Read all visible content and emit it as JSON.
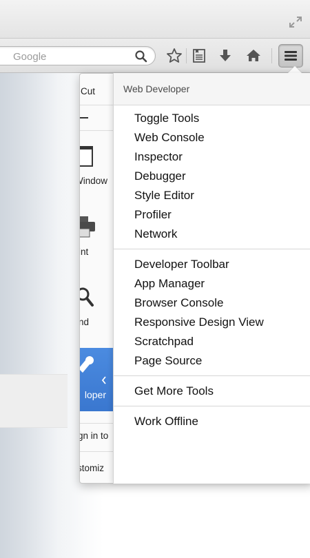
{
  "navbar": {
    "search_placeholder": "Google"
  },
  "main_menu": {
    "cut_label": "Cut",
    "new_window_label": "Window",
    "print_label": "int",
    "find_label": "nd",
    "developer_label": "loper",
    "sign_in_label": "gn in to",
    "customize_label": "stomiz"
  },
  "web_developer": {
    "title": "Web Developer",
    "groups": [
      [
        "Toggle Tools",
        "Web Console",
        "Inspector",
        "Debugger",
        "Style Editor",
        "Profiler",
        "Network"
      ],
      [
        "Developer Toolbar",
        "App Manager",
        "Browser Console",
        "Responsive Design View",
        "Scratchpad",
        "Page Source"
      ],
      [
        "Get More Tools"
      ],
      [
        "Work Offline"
      ]
    ]
  },
  "colors": {
    "developer_tile": "#3f7fd6",
    "toolbar_bg": "#e4e4e4"
  }
}
